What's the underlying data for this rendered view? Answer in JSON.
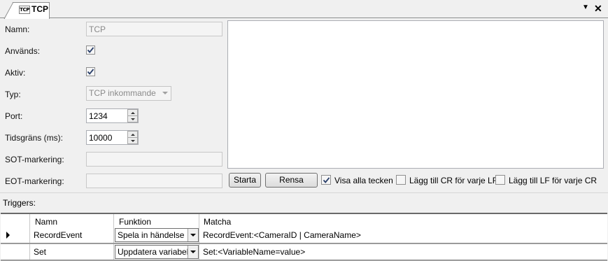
{
  "tab": {
    "icon_text": "TCP",
    "title": "TCP",
    "menu_glyph": "▼",
    "close_glyph": "✕"
  },
  "form": {
    "name_label": "Namn:",
    "name_value": "TCP",
    "used_label": "Används:",
    "used_checked": true,
    "active_label": "Aktiv:",
    "active_checked": true,
    "type_label": "Typ:",
    "type_value": "TCP inkommande",
    "port_label": "Port:",
    "port_value": "1234",
    "timeout_label": "Tidsgräns (ms):",
    "timeout_value": "10000",
    "sot_label": "SOT-markering:",
    "sot_value": "",
    "eot_label": "EOT-markering:",
    "eot_value": ""
  },
  "console": {
    "start_label": "Starta",
    "clear_label": "Rensa",
    "show_all_label": "Visa alla tecken",
    "show_all_checked": true,
    "add_cr_label": "Lägg till CR för varje LF",
    "add_cr_checked": false,
    "add_lf_label": "Lägg till LF för varje CR",
    "add_lf_checked": false
  },
  "triggers": {
    "label": "Triggers:",
    "columns": [
      "Namn",
      "Funktion",
      "Matcha"
    ],
    "rows": [
      {
        "name": "RecordEvent",
        "function": "Spela in händelse",
        "match": "RecordEvent:<CameraID | CameraName>",
        "current": true
      },
      {
        "name": "Set",
        "function": "Uppdatera variabel",
        "match": "Set:<VariableName=value>",
        "current": false
      }
    ]
  }
}
